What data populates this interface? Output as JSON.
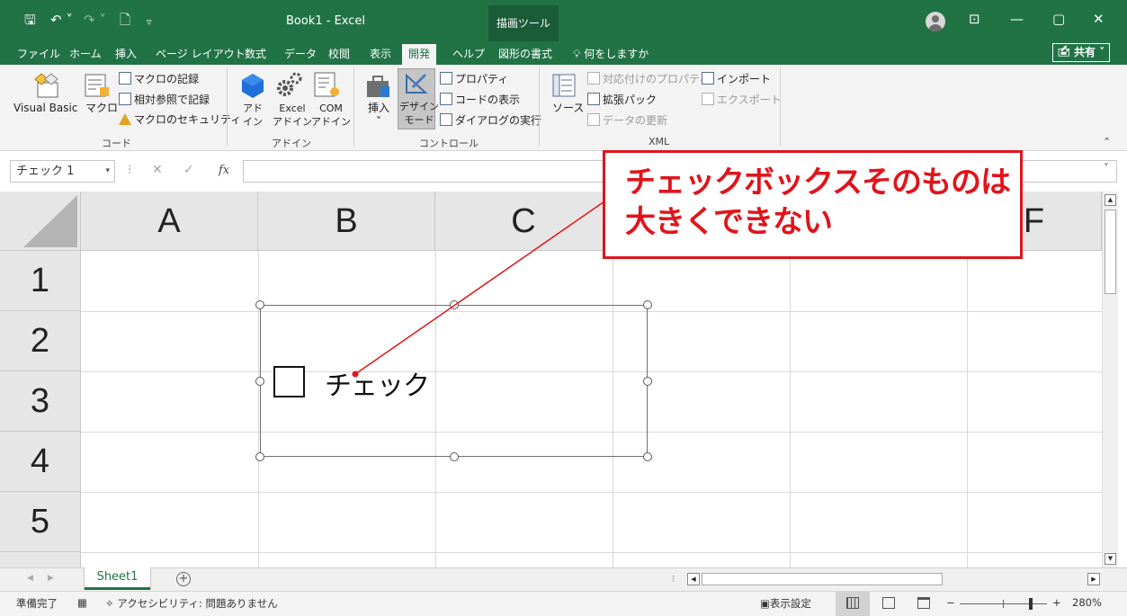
{
  "titlebar": {
    "title": "Book1  -  Excel",
    "context_tab": "描画ツール",
    "qa_save": "🖫",
    "qa_undo": "↶ ˅",
    "qa_redo": "↷ ˅",
    "qa_new": "🗋",
    "qa_more": "▿",
    "ribbon_display": "⊡",
    "minimize": "—",
    "restore": "▢",
    "close": "✕"
  },
  "tabs": [
    "ファイル",
    "ホーム",
    "挿入",
    "ページ レイアウト",
    "数式",
    "データ",
    "校閲",
    "表示",
    "開発",
    "ヘルプ",
    "図形の書式"
  ],
  "active_tab": "開発",
  "tell_me": "何をしますか",
  "tell_me_icon": "lightbulb-icon",
  "share": "🖆 共有 ˅",
  "ribbon": {
    "code": {
      "label": "コード",
      "visual_basic": "Visual Basic",
      "macro": "マクロ",
      "record_macro": "マクロの記録",
      "relative_ref": "相対参照で記録",
      "macro_security": "マクロのセキュリティ"
    },
    "addins": {
      "label": "アドイン",
      "addin_1": "アド",
      "addin_2": "イン",
      "excel_addin_1": "Excel",
      "excel_addin_2": "アドイン",
      "com_addin_1": "COM",
      "com_addin_2": "アドイン"
    },
    "controls": {
      "label": "コントロール",
      "insert": "挿入",
      "insert_arrow": "˅",
      "design_mode_1": "デザイン",
      "design_mode_2": "モード",
      "properties": "プロパティ",
      "view_code": "コードの表示",
      "run_dialog": "ダイアログの実行"
    },
    "xml": {
      "label": "XML",
      "source": "ソース",
      "map_properties": "対応付けのプロパティ",
      "expansion_packs": "拡張パック",
      "refresh_data": "データの更新",
      "import": "インポート",
      "export": "エクスポート"
    },
    "collapse": "⌃"
  },
  "formula_bar": {
    "name_box": "チェック 1",
    "name_box_arrow": "▾",
    "dots": "⁝",
    "cancel": "✕",
    "enter": "✓",
    "fx": "fx",
    "formula": "",
    "expand": "˅"
  },
  "grid": {
    "columns": [
      "A",
      "B",
      "C",
      "D",
      "E",
      "F"
    ],
    "rows": [
      "1",
      "2",
      "3",
      "4",
      "5"
    ]
  },
  "checkbox": {
    "label": "チェック",
    "checked": false
  },
  "callout": {
    "line1": "チェックボックスそのものは",
    "line2": "大きくできない",
    "color": "#e0141b"
  },
  "sheets": {
    "nav_prev": "◀",
    "nav_next": "▶",
    "tabs": [
      "Sheet1"
    ],
    "add": "+",
    "dots": "⁝",
    "scroll_left": "◀",
    "scroll_right": "▶"
  },
  "statusbar": {
    "status": "準備完了",
    "accessibility": "アクセシビリティ: 問題ありません",
    "display_settings": "表示設定",
    "zoom_minus": "−",
    "zoom_plus": "+",
    "zoom": "280%"
  },
  "colors": {
    "excel_green": "#217346",
    "ribbon_bg": "#f3f3f3",
    "header_bg": "#e6e6e6"
  }
}
